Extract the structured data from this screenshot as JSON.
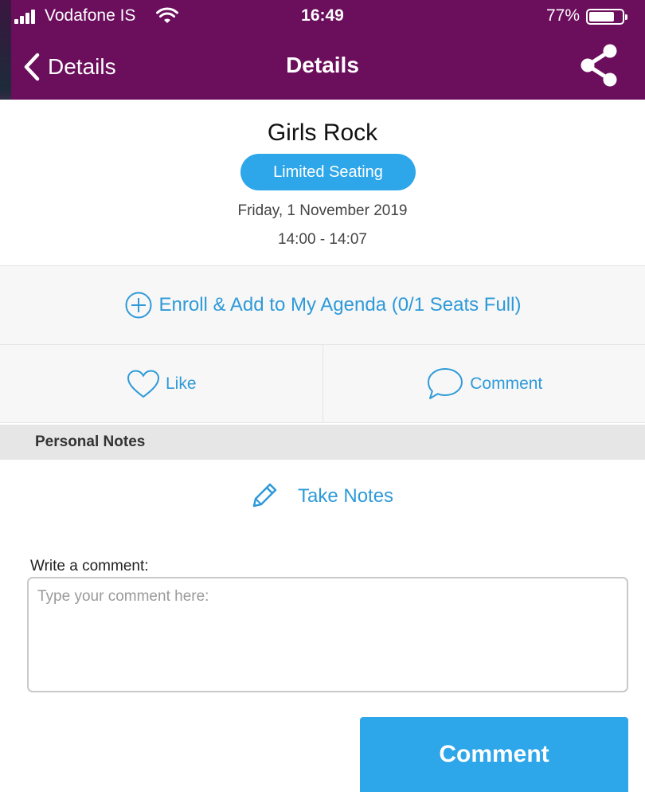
{
  "status_bar": {
    "carrier": "Vodafone IS",
    "time": "16:49",
    "battery_percent_label": "77%",
    "battery_level": 0.77
  },
  "nav": {
    "back_label": "Details",
    "title": "Details",
    "share_icon": "share-icon"
  },
  "event": {
    "title": "Girls Rock",
    "badge": "Limited Seating",
    "date": "Friday, 1 November 2019",
    "time": "14:00 - 14:07"
  },
  "actions": {
    "enroll_label": "Enroll & Add to My Agenda (0/1 Seats Full)",
    "like_label": "Like",
    "comment_label": "Comment"
  },
  "notes": {
    "header": "Personal Notes",
    "take_notes_label": "Take Notes"
  },
  "comment_form": {
    "label": "Write a comment:",
    "placeholder": "Type your comment here:",
    "value": "",
    "submit_label": "Comment"
  },
  "colors": {
    "nav_bar": "#6b0e5c",
    "accent": "#2ea6ea",
    "link": "#2e9ad9",
    "section_bg": "#f7f7f7"
  }
}
